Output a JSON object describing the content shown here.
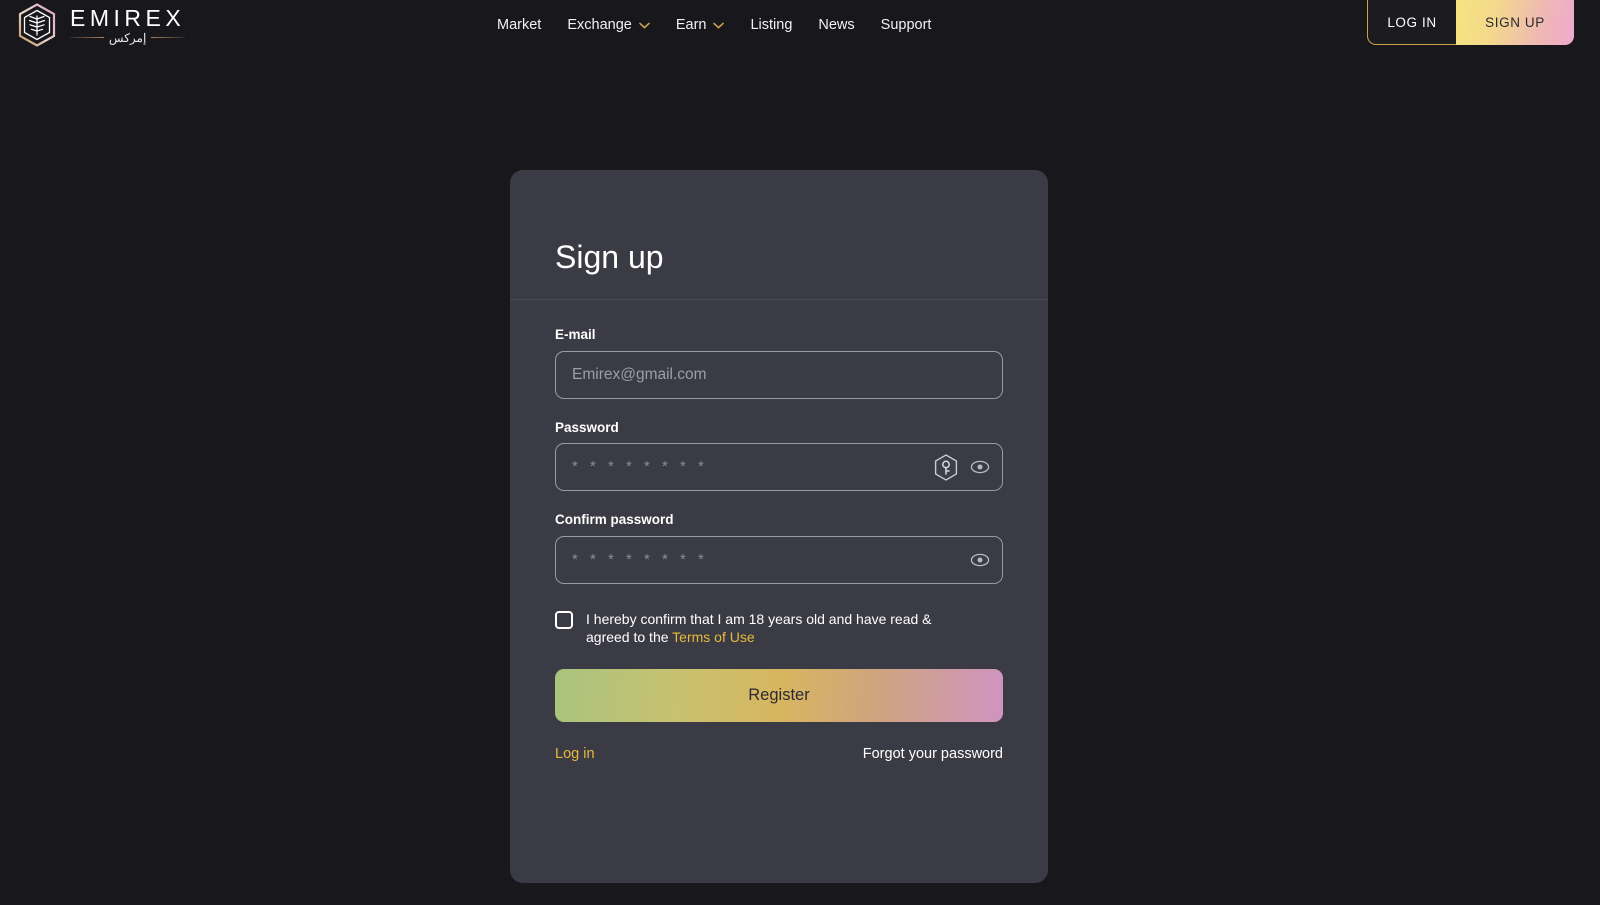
{
  "brand": {
    "wordmark": "EMIREX",
    "arabic": "إمركس",
    "logo_icon": "emirex-hex-palm-logo",
    "accent_gold": "#e8b93c",
    "accent_pink": "#efa8cf"
  },
  "nav": {
    "items": [
      {
        "label": "Market",
        "has_chevron": false
      },
      {
        "label": "Exchange",
        "has_chevron": true
      },
      {
        "label": "Earn",
        "has_chevron": true
      },
      {
        "label": "Listing",
        "has_chevron": false
      },
      {
        "label": "News",
        "has_chevron": false
      },
      {
        "label": "Support",
        "has_chevron": false
      }
    ]
  },
  "auth": {
    "login_label": "LOG IN",
    "signup_label": "SIGN UP"
  },
  "card": {
    "title": "Sign up",
    "email": {
      "label": "E-mail",
      "placeholder": "Emirex@gmail.com",
      "value": ""
    },
    "password": {
      "label": "Password",
      "placeholder": "* * * * * * * *",
      "value": "",
      "key_icon": "key-hexagon-icon",
      "reveal_icon": "eye-icon"
    },
    "confirm_password": {
      "label": "Confirm password",
      "placeholder": "* * * * * * * *",
      "value": "",
      "reveal_icon": "eye-icon"
    },
    "consent": {
      "checked": false,
      "text_before": "I hereby confirm that I am 18 years old and have read & agreed to the ",
      "link_label": "Terms of Use"
    },
    "register_label": "Register",
    "login_link": "Log in",
    "forgot_link": "Forgot your password"
  }
}
